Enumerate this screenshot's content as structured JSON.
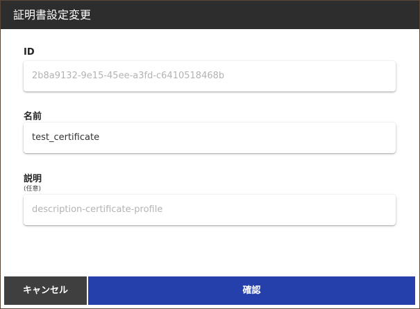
{
  "dialog": {
    "title": "証明書設定変更"
  },
  "fields": {
    "id": {
      "label": "ID",
      "placeholder": "2b8a9132-9e15-45ee-a3fd-c6410518468b"
    },
    "name": {
      "label": "名前",
      "value": "test_certificate"
    },
    "description": {
      "label": "説明",
      "sublabel": "(任意)",
      "placeholder": "description-certificate-profile"
    }
  },
  "footer": {
    "cancel_label": "キャンセル",
    "confirm_label": "確認"
  },
  "colors": {
    "header_bg": "#2d2d2d",
    "cancel_bg": "#3f3f3f",
    "confirm_bg": "#2540aa"
  }
}
